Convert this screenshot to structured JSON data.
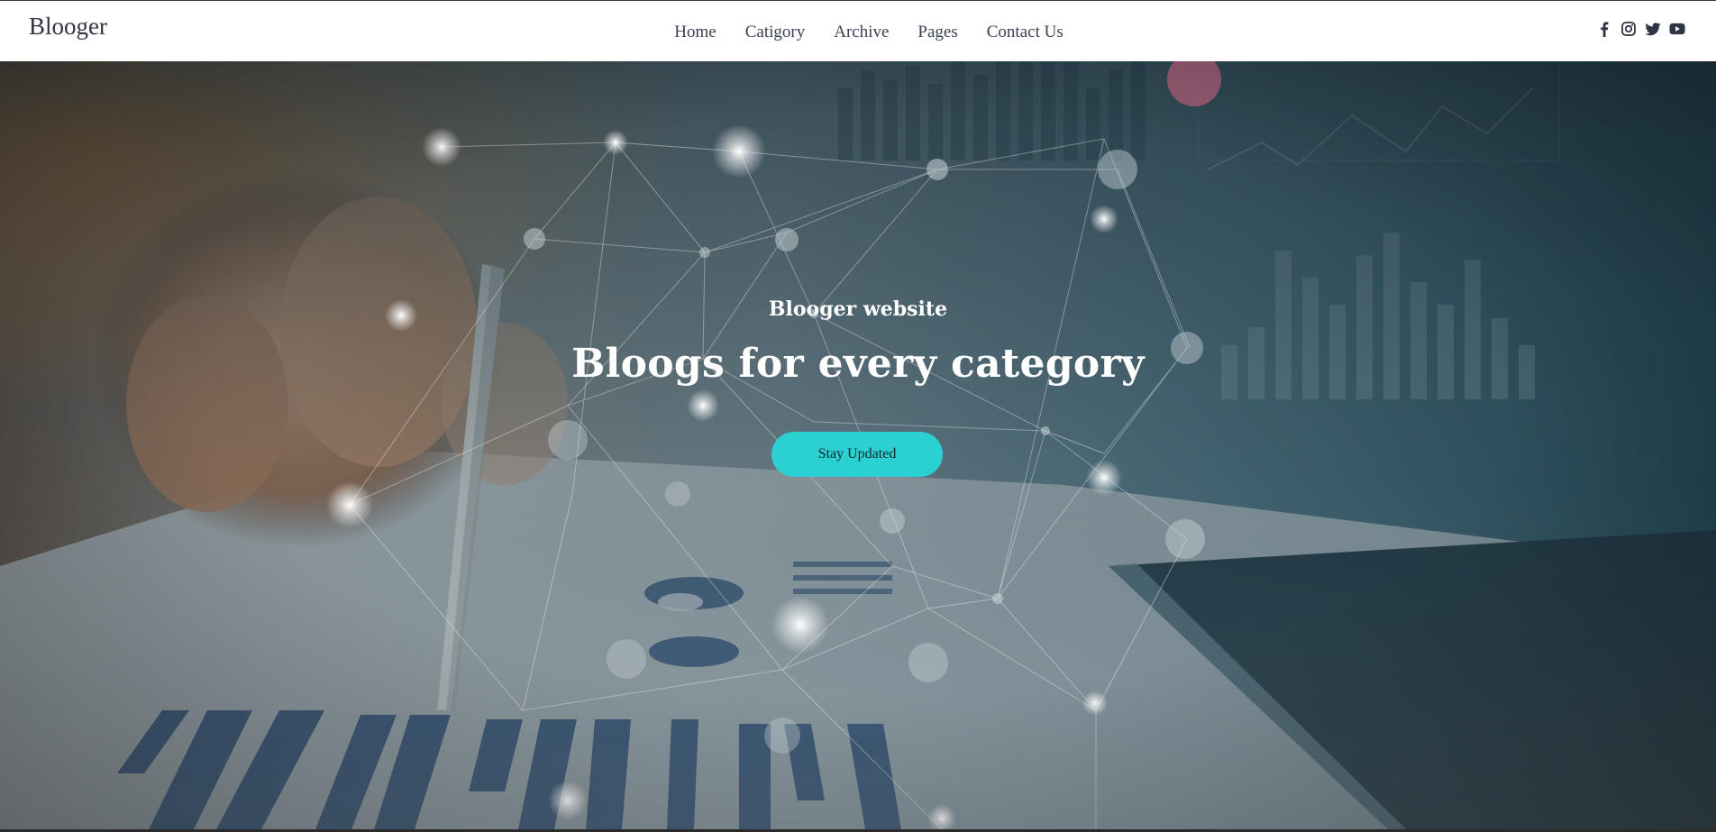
{
  "nav": {
    "brand": "Blooger",
    "links": [
      "Home",
      "Catigory",
      "Archive",
      "Pages",
      "Contact Us"
    ],
    "socials": [
      "facebook-icon",
      "instagram-icon",
      "twitter-icon",
      "youtube-icon"
    ],
    "social_color": "#2f3542"
  },
  "hero": {
    "kicker": "Blooger website",
    "title": "Bloogs for every category",
    "cta_label": "Stay Updated",
    "cta_color": "#2bd0d2"
  }
}
